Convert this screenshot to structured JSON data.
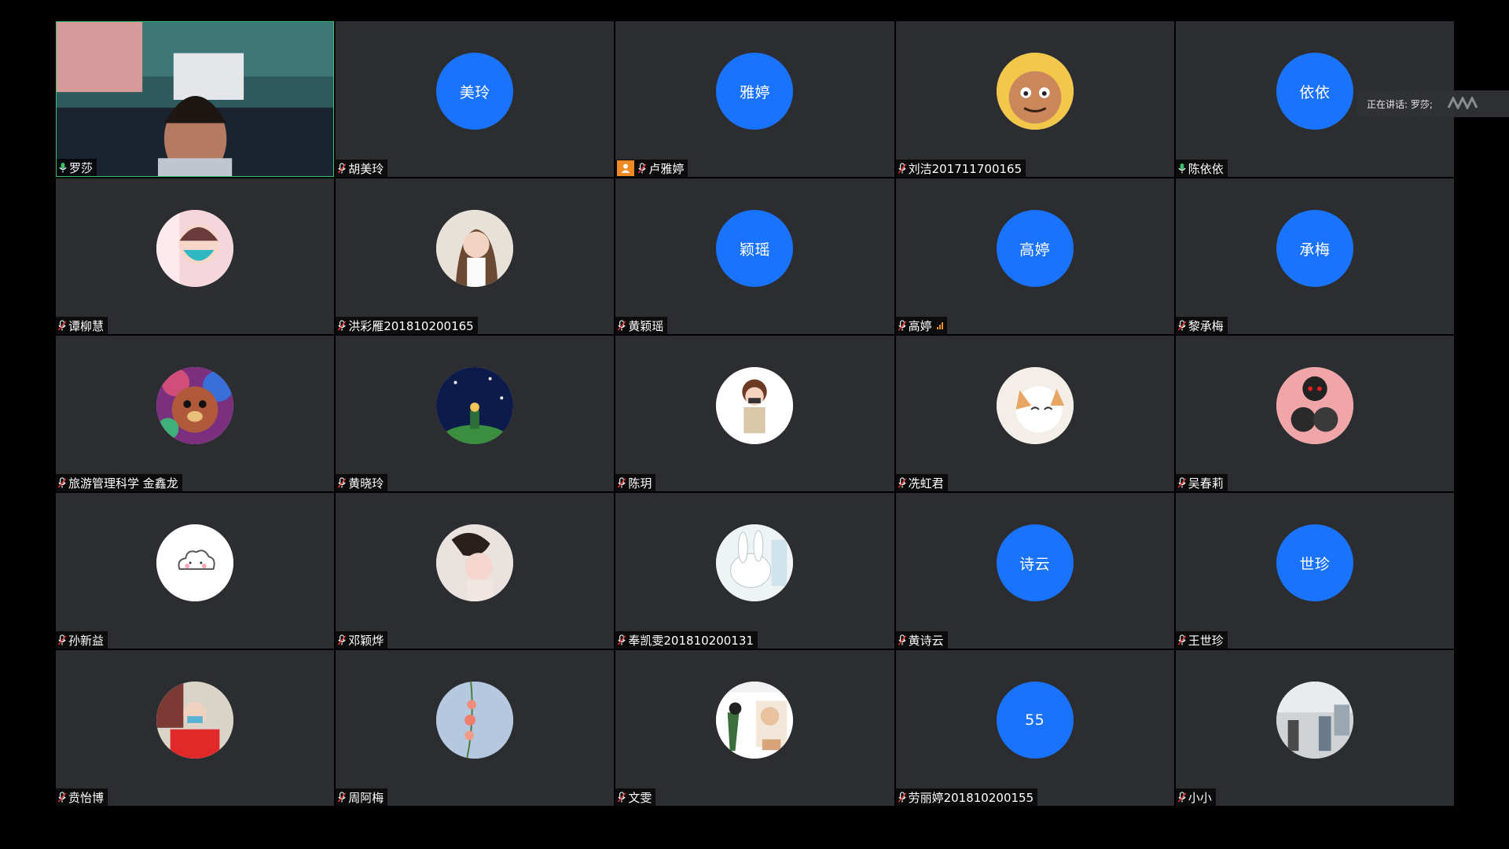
{
  "speaking": {
    "text": "正在讲话: 罗莎;"
  },
  "colors": {
    "avatar_blue": "#1a73ff",
    "tile_bg": "#2b2d31",
    "host_badge": "#f08a24",
    "active_border": "#3fc06b"
  },
  "participants": [
    {
      "name": "罗莎",
      "type": "video",
      "mic": "active-mic-icon"
    },
    {
      "name": "胡美玲",
      "type": "initials",
      "initials": "美玲",
      "mic": "muted-mic-icon"
    },
    {
      "name": "卢雅婷",
      "type": "initials",
      "initials": "雅婷",
      "mic": "muted-mic-icon",
      "host": true
    },
    {
      "name": "刘洁201711700165",
      "type": "image",
      "icon": "cartoon-cat-avatar",
      "mic": "muted-mic-icon"
    },
    {
      "name": "陈依依",
      "type": "initials",
      "initials": "依依",
      "mic": "active-mic-icon"
    },
    {
      "name": "谭柳慧",
      "type": "image",
      "icon": "masked-girl-avatar",
      "mic": "muted-mic-icon"
    },
    {
      "name": "洪彩雁201810200165",
      "type": "image",
      "icon": "woman-photo-avatar",
      "mic": "muted-mic-icon"
    },
    {
      "name": "黄颖瑶",
      "type": "initials",
      "initials": "颖瑶",
      "mic": "muted-mic-icon"
    },
    {
      "name": "高婷",
      "type": "initials",
      "initials": "高婷",
      "mic": "muted-mic-icon",
      "signal": true
    },
    {
      "name": "黎承梅",
      "type": "initials",
      "initials": "承梅",
      "mic": "muted-mic-icon"
    },
    {
      "name": "旅游管理科学 金鑫龙",
      "type": "image",
      "icon": "colorful-bear-avatar",
      "mic": "muted-mic-icon"
    },
    {
      "name": "黄晓玲",
      "type": "image",
      "icon": "night-sky-prince-avatar",
      "mic": "muted-mic-icon"
    },
    {
      "name": "陈玥",
      "type": "image",
      "icon": "cartoon-boy-avatar",
      "mic": "muted-mic-icon"
    },
    {
      "name": "冼虹君",
      "type": "image",
      "icon": "cartoon-dog-avatar",
      "mic": "muted-mic-icon"
    },
    {
      "name": "吴春莉",
      "type": "image",
      "icon": "anime-couple-avatar",
      "mic": "muted-mic-icon"
    },
    {
      "name": "孙新益",
      "type": "image",
      "icon": "cloud-avatar",
      "mic": "muted-mic-icon"
    },
    {
      "name": "邓颖烨",
      "type": "image",
      "icon": "woman-portrait-avatar",
      "mic": "muted-mic-icon"
    },
    {
      "name": "奉凯雯201810200131",
      "type": "image",
      "icon": "white-rabbit-avatar",
      "mic": "muted-mic-icon"
    },
    {
      "name": "黄诗云",
      "type": "initials",
      "initials": "诗云",
      "mic": "muted-mic-icon"
    },
    {
      "name": "王世珍",
      "type": "initials",
      "initials": "世珍",
      "mic": "muted-mic-icon"
    },
    {
      "name": "贲怡博",
      "type": "image",
      "icon": "masked-person-avatar",
      "mic": "muted-mic-icon"
    },
    {
      "name": "周阿梅",
      "type": "image",
      "icon": "flower-sky-avatar",
      "mic": "muted-mic-icon"
    },
    {
      "name": "文雯",
      "type": "image",
      "icon": "comic-meme-avatar",
      "mic": "muted-mic-icon"
    },
    {
      "name": "劳丽婷201810200155",
      "type": "initials",
      "initials": "55",
      "mic": "muted-mic-icon"
    },
    {
      "name": "小小",
      "type": "image",
      "icon": "street-people-avatar",
      "mic": "muted-mic-icon"
    }
  ]
}
